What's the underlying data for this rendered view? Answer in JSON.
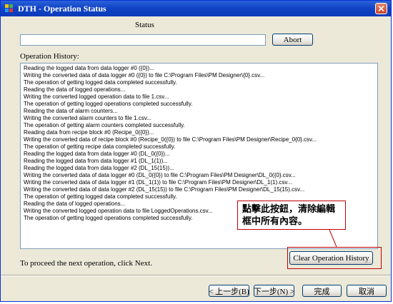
{
  "window": {
    "title": "DTH - Operation Status"
  },
  "status": {
    "label": "Status",
    "value": "",
    "abort_label": "Abort"
  },
  "history": {
    "label": "Operation History:",
    "lines": [
      "Reading the logged data from data logger #0 ({0})...",
      "Writing the converted data of data logger #0 ({0}) to file C:\\Program Files\\PM Designer\\{0}.csv...",
      "The operation of getting logged data completed successfully.",
      "Reading the data of logged operations...",
      "Writing the converted logged operation data to file 1.csv...",
      "The operation of getting logged operations completed successfully.",
      "Reading the data of alarm counters...",
      "Writing the converted alarm counters to file 1.csv...",
      "The operation of getting alarm counters completed successfully.",
      "Reading data from recipe block #0 (Recipe_0({0})...",
      "Writing the converted data of recipe block #0 (Recipe_0({0}) to file C:\\Program Files\\PM Designer\\Recipe_0{0}.csv...",
      "The operation of getting recipe data completed successfully.",
      "Reading the logged data from data logger #0 (DL_0({0})...",
      "Reading the logged data from data logger #1 (DL_1(1))...",
      "Reading the logged data from data logger #2 (DL_15(15))...",
      "Writing the converted data of data logger #0 (DL_0({0}) to file C:\\Program Files\\PM Designer\\DL_0({0}.csv...",
      "Writing the converted data of data logger #1 (DL_1(1)) to file C:\\Program Files\\PM Designer\\DL_1(1).csv...",
      "Writing the converted data of data logger #2 (DL_15(15)) to file C:\\Program Files\\PM Designer\\DL_15(15).csv...",
      "The operation of getting logged data completed successfully.",
      "Reading the data of logged operations...",
      "Writing the converted logged operation data to file LoggedOperations.csv...",
      "The operation of getting logged operations completed successfully."
    ]
  },
  "annotation": {
    "text": "點擊此按鈕，清除編輯框中所有內容。"
  },
  "clear_label": "Clear Operation History",
  "instruction": "To proceed the next operation, click Next.",
  "footer": {
    "back_label": "< 上一步(B)",
    "next_label": "下一步(N) >",
    "finish_label": "完成",
    "cancel_label": "取消"
  }
}
